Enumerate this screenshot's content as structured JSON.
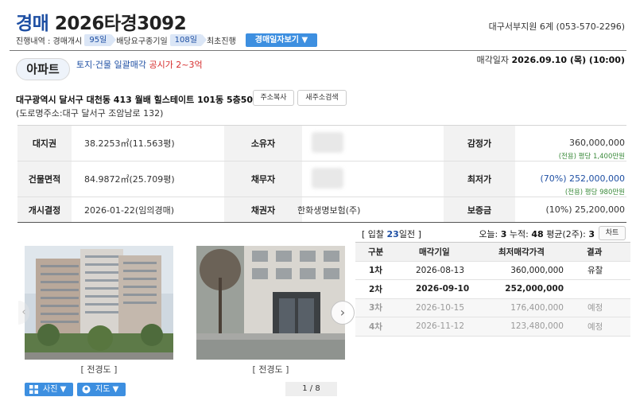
{
  "header": {
    "case_kind": "경매",
    "case_no": "2026타경3092",
    "court": "대구서부지원 6계 (053-570-2296)"
  },
  "progress": {
    "label": "진행내역 : 경매개시",
    "days1": "95일",
    "mid": "배당요구종기일",
    "days2": "108일",
    "tail": "최초진행",
    "schedule_button": "경매일자보기 ▼"
  },
  "property": {
    "type": "아파트",
    "note": "토지·건물 일괄매각",
    "note_red": "공시가 2~3억",
    "sale_date_label": "매각일자",
    "sale_date": "2026.09.10 (목) (10:00)",
    "address": "대구광역시 달서구 대천동 413 월배 힐스테이트 101동 5층508호",
    "copy_button": "주소복사",
    "new_search_button": "새주소검색",
    "road_address": "(도로명주소:대구 달서구 조암남로 132)"
  },
  "info": {
    "land_right_label": "대지권",
    "land_right": "38.2253㎡(11.563평)",
    "owner_label": "소유자",
    "appraisal_label": "감정가",
    "appraisal": "360,000,000",
    "appraisal_sub": "(전용) 평당 1,400만원",
    "building_label": "건물면적",
    "building": "84.9872㎡(25.709평)",
    "debtor_label": "채무자",
    "min_label": "최저가",
    "min_price": "(70%) 252,000,000",
    "min_sub": "(전용) 평당 980만원",
    "start_label": "개시결정",
    "start": "2026-01-22(임의경매)",
    "creditor_label": "채권자",
    "creditor": "한화생명보험(주)",
    "deposit_label": "보증금",
    "deposit": "(10%) 25,200,000"
  },
  "photos": {
    "caption1": "[ 전경도 ]",
    "caption2": "[ 전경도 ]",
    "pager": "1 / 8",
    "photo_button": "사진 ▼",
    "map_button": "지도 ▼"
  },
  "bid": {
    "prefix": "[ 입찰",
    "days": "23",
    "suffix": "일전 ]",
    "today_label": "오늘:",
    "today": "3",
    "total_label": "누적:",
    "total": "48",
    "avg_label": "평균(2주):",
    "avg": "3",
    "chart_button": "차트"
  },
  "schedule": {
    "headers": [
      "구분",
      "매각기일",
      "최저매각가격",
      "결과"
    ],
    "rows": [
      {
        "round": "1차",
        "date": "2026-08-13",
        "price": "360,000,000",
        "result": "유찰"
      },
      {
        "round": "2차",
        "date": "2026-09-10",
        "price": "252,000,000",
        "result": ""
      },
      {
        "round": "3차",
        "date": "2026-10-15",
        "price": "176,400,000",
        "result": "예정"
      },
      {
        "round": "4차",
        "date": "2026-11-12",
        "price": "123,480,000",
        "result": "예정"
      }
    ]
  },
  "colors": {
    "accent": "#1e4fa3",
    "button": "#3d8fe0",
    "highlight_red": "#d62d2d",
    "sub_green": "#3a8a3a"
  }
}
